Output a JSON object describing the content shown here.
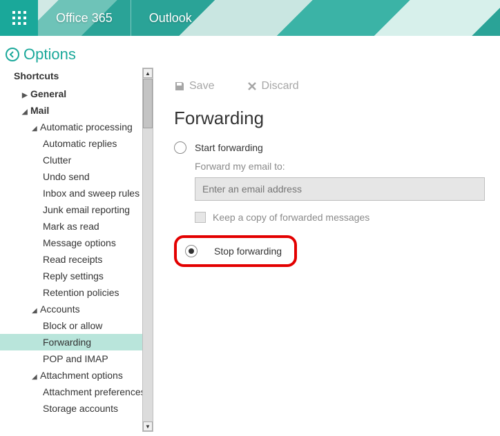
{
  "header": {
    "brand1": "Office 365",
    "brand2": "Outlook"
  },
  "options": {
    "label": "Options"
  },
  "sidebar": {
    "title": "Shortcuts",
    "general": "General",
    "mail": "Mail",
    "auto": "Automatic processing",
    "auto_items": {
      "replies": "Automatic replies",
      "clutter": "Clutter",
      "undo": "Undo send",
      "inbox": "Inbox and sweep rules",
      "junk": "Junk email reporting",
      "mark": "Mark as read",
      "msgopt": "Message options",
      "read": "Read receipts",
      "reply": "Reply settings",
      "retention": "Retention policies"
    },
    "accounts": "Accounts",
    "accounts_items": {
      "block": "Block or allow",
      "forwarding": "Forwarding",
      "pop": "POP and IMAP"
    },
    "attach": "Attachment options",
    "attach_items": {
      "prefs": "Attachment preferences",
      "storage": "Storage accounts"
    }
  },
  "toolbar": {
    "save": "Save",
    "discard": "Discard"
  },
  "page": {
    "title": "Forwarding",
    "start": "Start forwarding",
    "forward_label": "Forward my email to:",
    "placeholder": "Enter an email address",
    "keep_copy": "Keep a copy of forwarded messages",
    "stop": "Stop forwarding"
  }
}
